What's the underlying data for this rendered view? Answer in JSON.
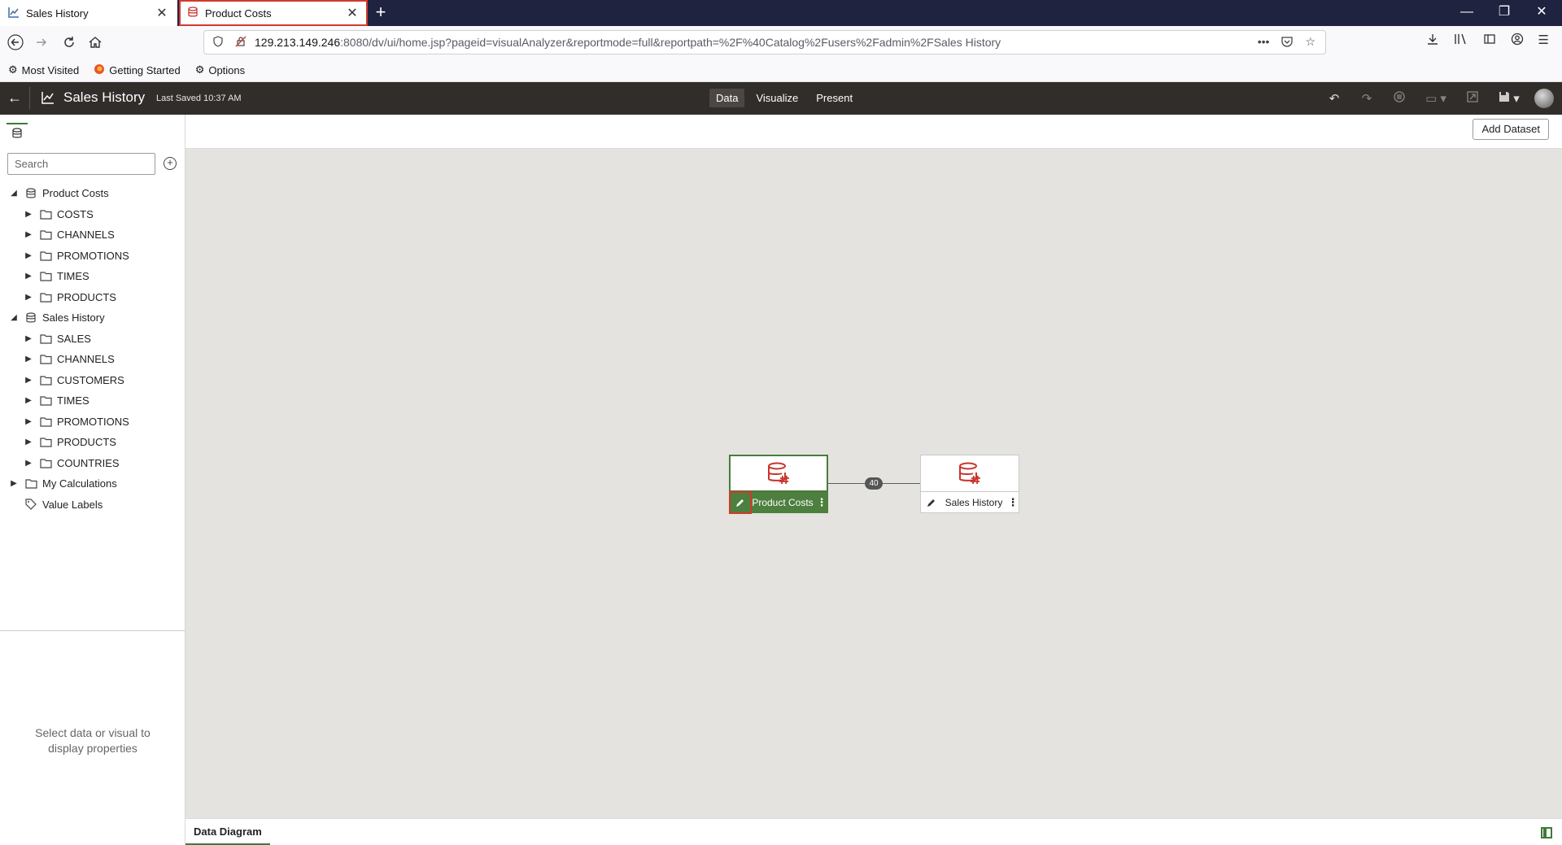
{
  "browser": {
    "tabs": [
      {
        "label": "Sales History",
        "active": false
      },
      {
        "label": "Product Costs",
        "active": true
      }
    ],
    "new_tab": "+",
    "url_host": "129.213.149.246",
    "url_rest": ":8080/dv/ui/home.jsp?pageid=visualAnalyzer&reportmode=full&reportpath=%2F%40Catalog%2Fusers%2Fadmin%2FSales History",
    "url_more": "•••",
    "bookmarks": [
      "Most Visited",
      "Getting Started",
      "Options"
    ],
    "window_controls": {
      "minimize": "—",
      "restore": "❐",
      "close": "✕"
    }
  },
  "app": {
    "title": "Sales History",
    "last_saved": "Last Saved 10:37 AM",
    "modes": [
      {
        "label": "Data",
        "active": true
      },
      {
        "label": "Visualize",
        "active": false
      },
      {
        "label": "Present",
        "active": false
      }
    ],
    "add_dataset_label": "Add Dataset"
  },
  "left_panel": {
    "search_placeholder": "Search",
    "tree": [
      {
        "label": "Product Costs",
        "type": "dataset",
        "expanded": true,
        "children": [
          "COSTS",
          "CHANNELS",
          "PROMOTIONS",
          "TIMES",
          "PRODUCTS"
        ]
      },
      {
        "label": "Sales History",
        "type": "dataset",
        "expanded": true,
        "children": [
          "SALES",
          "CHANNELS",
          "CUSTOMERS",
          "TIMES",
          "PROMOTIONS",
          "PRODUCTS",
          "COUNTRIES"
        ]
      },
      {
        "label": "My Calculations",
        "type": "folder",
        "expanded": false,
        "children": []
      },
      {
        "label": "Value Labels",
        "type": "tag",
        "expanded": false,
        "children": []
      }
    ],
    "properties_message": "Select data or visual to display properties"
  },
  "diagram": {
    "nodes": [
      {
        "label": "Product Costs",
        "selected": true
      },
      {
        "label": "Sales History",
        "selected": false
      }
    ],
    "join_count": "40"
  },
  "bottom": {
    "tab_label": "Data Diagram"
  },
  "colors": {
    "accent_green": "#4d7f3f",
    "highlight_red": "#d03a2c",
    "dataset_icon_red": "#c8352b",
    "header_bg": "#312d2a"
  }
}
